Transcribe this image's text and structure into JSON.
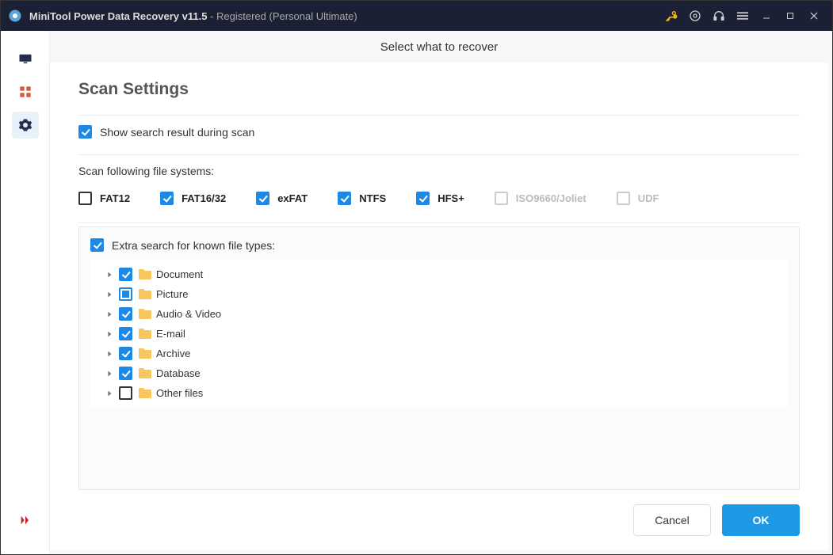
{
  "title": {
    "app": "MiniTool Power Data Recovery v11.5",
    "suffix": " - Registered (Personal Ultimate)"
  },
  "topbar": {
    "heading": "Select what to recover"
  },
  "settings": {
    "heading": "Scan Settings",
    "show_results_label": "Show search result during scan",
    "fs_heading": "Scan following file systems:",
    "fs": [
      {
        "label": "FAT12",
        "state": "unchecked",
        "disabled": false
      },
      {
        "label": "FAT16/32",
        "state": "checked",
        "disabled": false
      },
      {
        "label": "exFAT",
        "state": "checked",
        "disabled": false
      },
      {
        "label": "NTFS",
        "state": "checked",
        "disabled": false
      },
      {
        "label": "HFS+",
        "state": "checked",
        "disabled": false
      },
      {
        "label": "ISO9660/Joliet",
        "state": "unchecked",
        "disabled": true
      },
      {
        "label": "UDF",
        "state": "unchecked",
        "disabled": true
      }
    ],
    "extra_label": "Extra search for known file types:",
    "types": [
      {
        "label": "Document",
        "state": "checked"
      },
      {
        "label": "Picture",
        "state": "indeterminate"
      },
      {
        "label": "Audio & Video",
        "state": "checked"
      },
      {
        "label": "E-mail",
        "state": "checked"
      },
      {
        "label": "Archive",
        "state": "checked"
      },
      {
        "label": "Database",
        "state": "checked"
      },
      {
        "label": "Other files",
        "state": "unchecked"
      }
    ]
  },
  "buttons": {
    "cancel": "Cancel",
    "ok": "OK"
  },
  "icons": {
    "key": "key-icon",
    "disc": "disc-icon",
    "support": "headphones-icon",
    "menu": "menu-icon",
    "min": "minimize-icon",
    "max": "maximize-icon",
    "close": "close-icon",
    "side1": "monitor-icon",
    "side2": "apps-icon",
    "side3": "gear-icon",
    "side_toggle": "expand-icon"
  }
}
